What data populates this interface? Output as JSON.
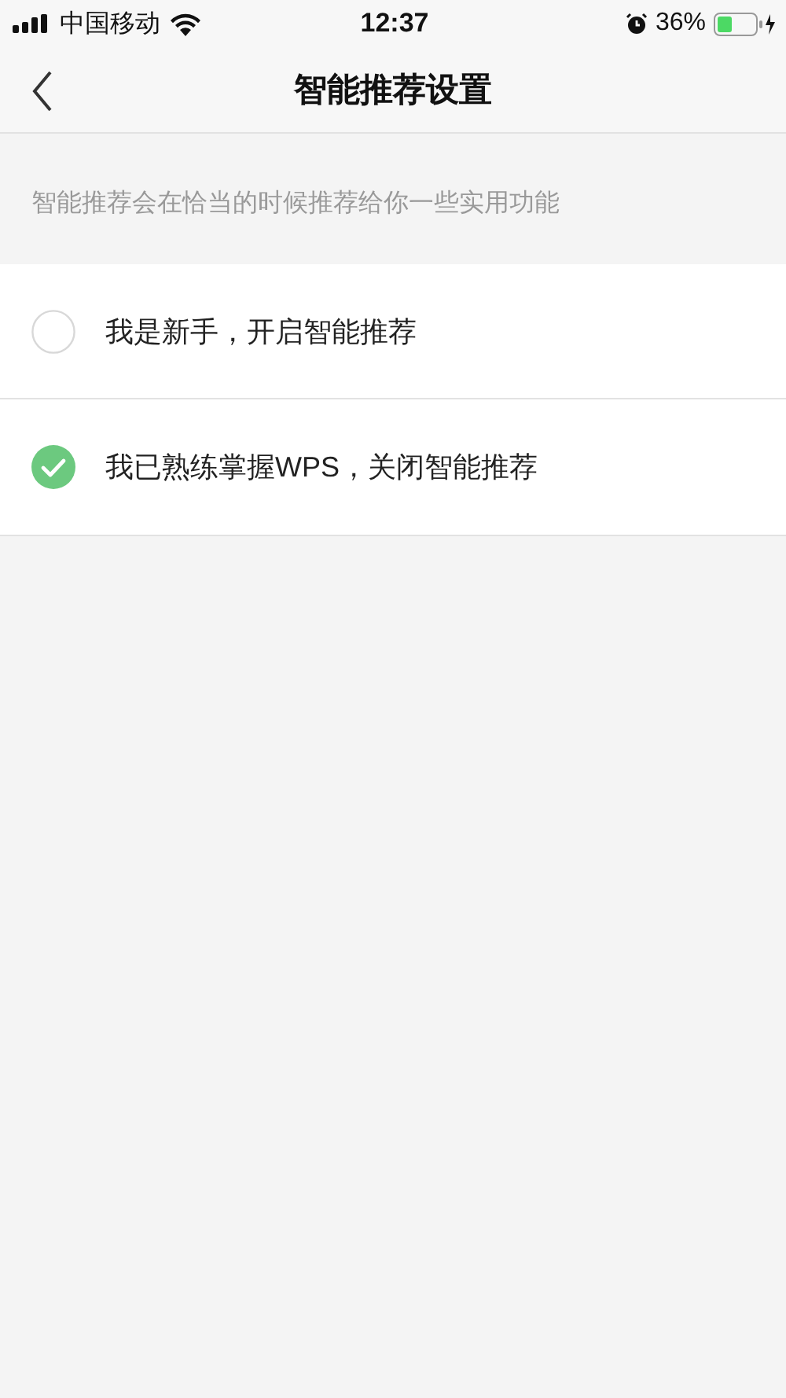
{
  "status_bar": {
    "carrier": "中国移动",
    "time": "12:37",
    "battery": "36%"
  },
  "nav": {
    "title": "智能推荐设置"
  },
  "description": "智能推荐会在恰当的时候推荐给你一些实用功能",
  "options": [
    {
      "label": "我是新手，开启智能推荐",
      "selected": false
    },
    {
      "label": "我已熟练掌握WPS，关闭智能推荐",
      "selected": true
    }
  ]
}
